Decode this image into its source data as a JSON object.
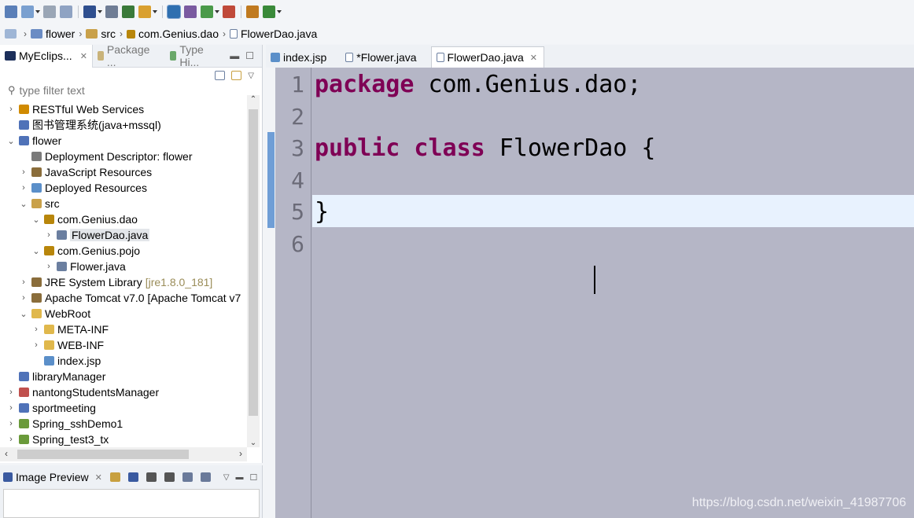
{
  "toolbar": {
    "buttons": [
      "new-icon",
      "new-project-icon",
      "save-icon",
      "save-all-icon",
      "print-icon",
      "run-icon",
      "debug-icon",
      "search-icon",
      "deploy-icon",
      "server-icon",
      "open-type-icon",
      "refactor-icon",
      "back-icon",
      "forward-icon"
    ]
  },
  "breadcrumb": {
    "items": [
      "flower",
      "src",
      "com.Genius.dao",
      "FlowerDao.java"
    ]
  },
  "left_panel": {
    "tabs": [
      {
        "label": "MyEclips...",
        "active": true
      },
      {
        "label": "Package ...",
        "active": false
      },
      {
        "label": "Type Hi...",
        "active": false
      }
    ],
    "filter_placeholder": "type filter text",
    "tree": [
      {
        "label": "RESTful Web Services",
        "depth": 0,
        "toggle": ">",
        "icon": "rest-icon",
        "color": "#d08a00"
      },
      {
        "label": "图书管理系统(java+mssql)",
        "depth": 0,
        "toggle": "",
        "icon": "project-icon",
        "color": "#4f72b8"
      },
      {
        "label": "flower",
        "depth": 0,
        "toggle": "v",
        "icon": "web-project-icon",
        "color": "#4f72b8"
      },
      {
        "label": "Deployment Descriptor: flower",
        "depth": 1,
        "toggle": "",
        "icon": "descriptor-icon",
        "color": "#7a7a7a"
      },
      {
        "label": "JavaScript Resources",
        "depth": 1,
        "toggle": ">",
        "icon": "library-icon",
        "color": "#8a6d3b"
      },
      {
        "label": "Deployed Resources",
        "depth": 1,
        "toggle": ">",
        "icon": "deployed-icon",
        "color": "#5b8fc9"
      },
      {
        "label": "src",
        "depth": 1,
        "toggle": "v",
        "icon": "source-folder-icon",
        "color": "#c9a14a"
      },
      {
        "label": "com.Genius.dao",
        "depth": 2,
        "toggle": "v",
        "icon": "package-icon",
        "color": "#b8860b"
      },
      {
        "label": "FlowerDao.java",
        "depth": 3,
        "toggle": ">",
        "icon": "java-file-icon",
        "color": "#6b7fa0",
        "selected": true
      },
      {
        "label": "com.Genius.pojo",
        "depth": 2,
        "toggle": "v",
        "icon": "package-icon",
        "color": "#b8860b"
      },
      {
        "label": "Flower.java",
        "depth": 3,
        "toggle": ">",
        "icon": "java-file-icon",
        "color": "#6b7fa0"
      },
      {
        "label": "JRE System Library",
        "suffix": "[jre1.8.0_181]",
        "depth": 1,
        "toggle": ">",
        "icon": "library-icon",
        "color": "#8a6d3b"
      },
      {
        "label": "Apache Tomcat v7.0 [Apache Tomcat v7",
        "depth": 1,
        "toggle": ">",
        "icon": "library-icon",
        "color": "#8a6d3b"
      },
      {
        "label": "WebRoot",
        "depth": 1,
        "toggle": "v",
        "icon": "folder-icon",
        "color": "#e0b84c"
      },
      {
        "label": "META-INF",
        "depth": 2,
        "toggle": ">",
        "icon": "folder-icon",
        "color": "#e0b84c"
      },
      {
        "label": "WEB-INF",
        "depth": 2,
        "toggle": ">",
        "icon": "folder-icon",
        "color": "#e0b84c"
      },
      {
        "label": "index.jsp",
        "depth": 2,
        "toggle": "",
        "icon": "jsp-file-icon",
        "color": "#5b8fc9"
      },
      {
        "label": "libraryManager",
        "depth": 0,
        "toggle": "",
        "icon": "project-icon",
        "color": "#4f72b8"
      },
      {
        "label": "nantongStudentsManager",
        "depth": 0,
        "toggle": ">",
        "icon": "web-project-icon",
        "color": "#c0504d"
      },
      {
        "label": "sportmeeting",
        "depth": 0,
        "toggle": ">",
        "icon": "web-project-icon",
        "color": "#4f72b8"
      },
      {
        "label": "Spring_sshDemo1",
        "depth": 0,
        "toggle": ">",
        "icon": "spring-project-icon",
        "color": "#6a9a3a"
      },
      {
        "label": "Spring_test3_tx",
        "depth": 0,
        "toggle": ">",
        "icon": "spring-project-icon",
        "color": "#6a9a3a"
      }
    ]
  },
  "preview": {
    "tab_label": "Image Preview",
    "tools": [
      "sync-icon",
      "image-icon",
      "zoom-out-icon",
      "zoom-in-icon",
      "actual-size-icon",
      "fit-icon"
    ]
  },
  "editor": {
    "tabs": [
      {
        "label": "index.jsp",
        "active": false
      },
      {
        "label": "*Flower.java",
        "active": false
      },
      {
        "label": "FlowerDao.java",
        "active": true
      }
    ],
    "line_numbers": [
      "1",
      "2",
      "3",
      "4",
      "5",
      "6"
    ],
    "lines": [
      {
        "kw": "package",
        "rest": " com.Genius.dao;"
      },
      {
        "kw": "",
        "rest": ""
      },
      {
        "kw": "public class",
        "rest": " FlowerDao {"
      },
      {
        "kw": "",
        "rest": ""
      },
      {
        "kw": "",
        "rest": "}"
      },
      {
        "kw": "",
        "rest": ""
      }
    ],
    "current_line": 5
  },
  "watermark": "https://blog.csdn.net/weixin_41987706"
}
